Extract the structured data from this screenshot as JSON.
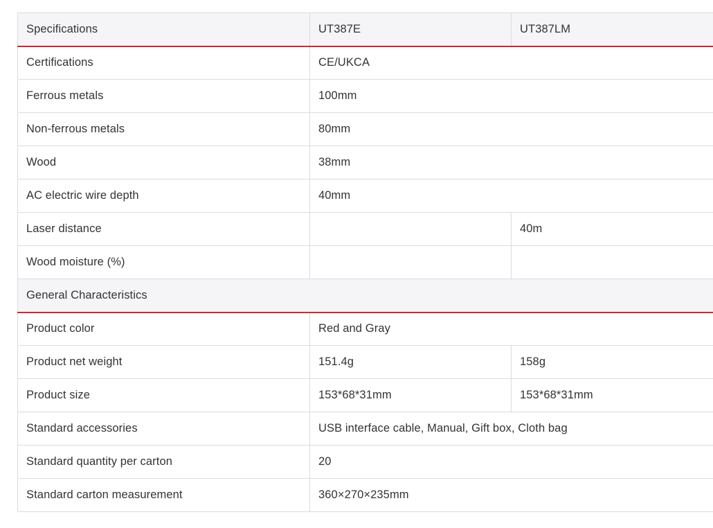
{
  "table": {
    "header": [
      "Specifications",
      "UT387E",
      "UT387LM"
    ],
    "rows": [
      {
        "label": "Certifications",
        "span": "CE/UKCA"
      },
      {
        "label": "Ferrous metals",
        "span": "100mm"
      },
      {
        "label": "Non-ferrous metals",
        "span": "80mm"
      },
      {
        "label": "Wood",
        "span": "38mm"
      },
      {
        "label": "AC electric wire depth",
        "span": "40mm"
      },
      {
        "label": "Laser distance",
        "c1": "",
        "c2": "40m"
      },
      {
        "label": "Wood moisture (%)",
        "c1": "",
        "c2": ""
      }
    ],
    "section2_title": "General Characteristics",
    "rows2": [
      {
        "label": "Product color",
        "span": "Red and Gray"
      },
      {
        "label": "Product net weight",
        "c1": "151.4g",
        "c2": "158g"
      },
      {
        "label": "Product size",
        "c1": "153*68*31mm",
        "c2": "153*68*31mm"
      },
      {
        "label": "Standard accessories",
        "span": "USB interface cable, Manual, Gift box, Cloth bag"
      },
      {
        "label": "Standard quantity per carton",
        "span": "20"
      },
      {
        "label": "Standard carton measurement",
        "span": "360×270×235mm"
      }
    ]
  },
  "colors": {
    "accent_line": "#d22630",
    "header_bg": "#f5f5f7",
    "border": "#dcdcdc",
    "text": "#333333"
  }
}
